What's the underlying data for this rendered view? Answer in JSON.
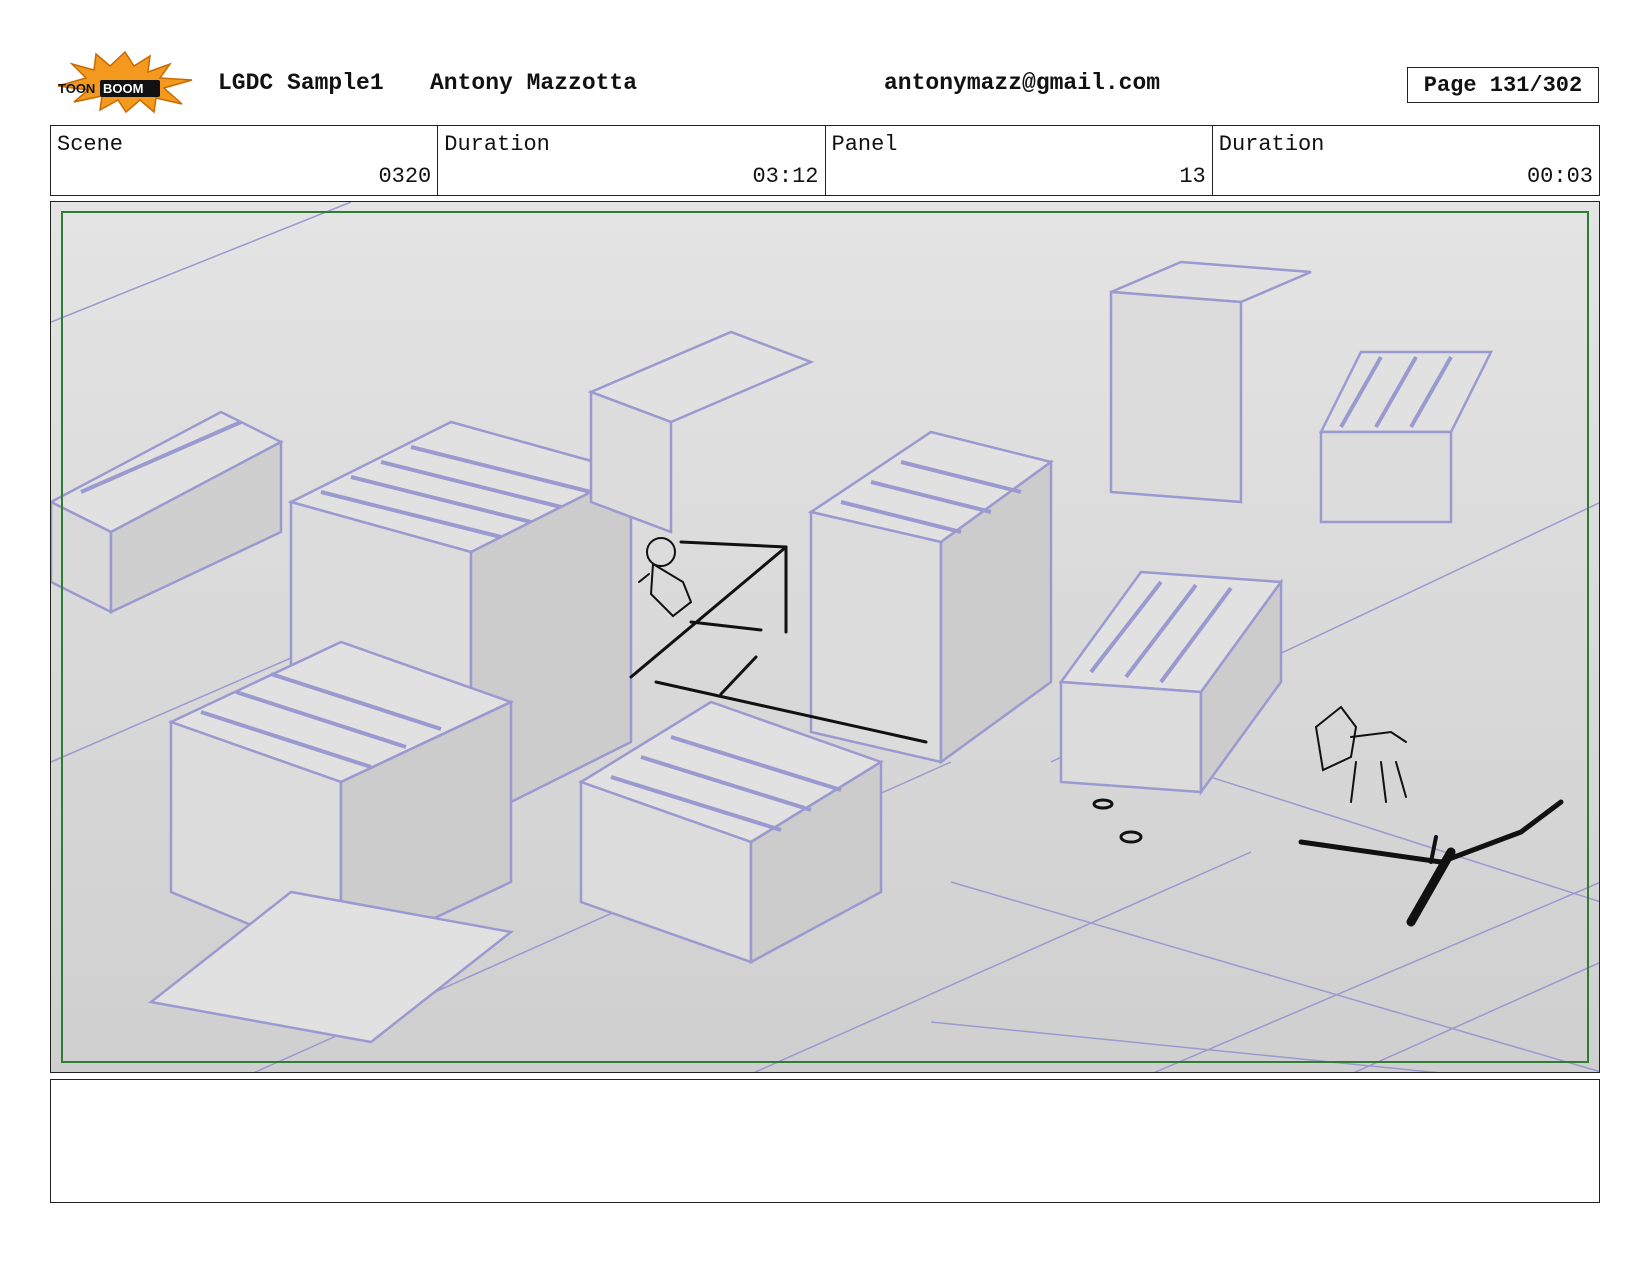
{
  "header": {
    "logo_text": "TOON BOOM",
    "project": "LGDC Sample1",
    "author": "Antony Mazzotta",
    "email": "antonymazz@gmail.com",
    "page": "Page 131/302"
  },
  "info": {
    "scene_label": "Scene",
    "scene_value": "0320",
    "scene_duration_label": "Duration",
    "scene_duration_value": "03:12",
    "panel_label": "Panel",
    "panel_value": "13",
    "panel_duration_label": "Duration",
    "panel_duration_value": "00:03"
  },
  "panel": {
    "frame_color": "#2e7d32",
    "background_color": "#d3d3d3",
    "line_color": "#9a9ad0"
  },
  "notes": {
    "text": ""
  }
}
